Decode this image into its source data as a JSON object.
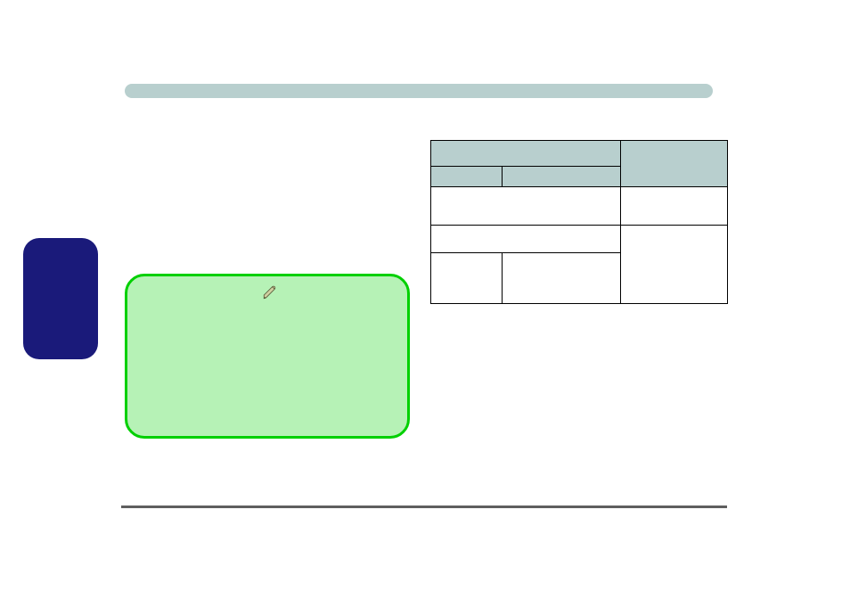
{
  "shapes": {
    "top_bar": {
      "color": "#b8cfce"
    },
    "blue_box": {
      "color": "#1a1a7a"
    },
    "green_panel": {
      "fill": "#b6f2b6",
      "stroke": "#00d000"
    }
  },
  "icons": {
    "pen": "pen-icon"
  },
  "table": {
    "header_color": "#b8cfce",
    "rows": 5,
    "note": "no visible text"
  }
}
